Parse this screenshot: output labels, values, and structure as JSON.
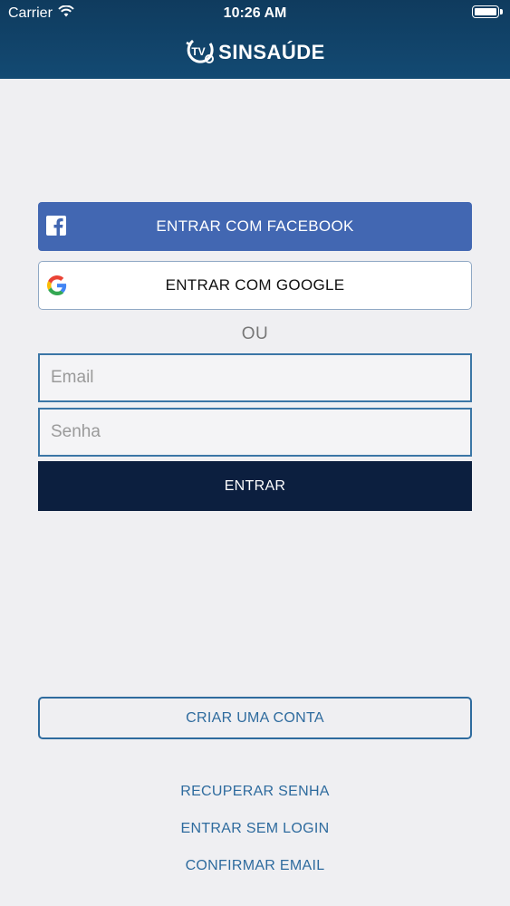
{
  "status_bar": {
    "carrier": "Carrier",
    "time": "10:26 AM",
    "wifi_icon": "wifi-icon",
    "battery_icon": "battery-icon"
  },
  "header": {
    "logo_badge": "TV",
    "logo_text": "SINSAÚDE",
    "logo_icon": "tv-logo-icon"
  },
  "social": {
    "facebook_label": "ENTRAR COM FACEBOOK",
    "facebook_icon": "facebook-icon",
    "facebook_color": "#4267b2",
    "google_label": "ENTRAR COM GOOGLE",
    "google_icon": "google-icon"
  },
  "divider_text": "OU",
  "form": {
    "email_placeholder": "Email",
    "email_value": "",
    "password_placeholder": "Senha",
    "password_value": "",
    "submit_label": "ENTRAR",
    "submit_color": "#0c1f3f"
  },
  "footer": {
    "create_account_label": "CRIAR UMA CONTA",
    "recover_password_label": "RECUPERAR SENHA",
    "no_login_label": "ENTRAR SEM LOGIN",
    "confirm_email_label": "CONFIRMAR EMAIL",
    "link_color": "#2e6b9e"
  }
}
